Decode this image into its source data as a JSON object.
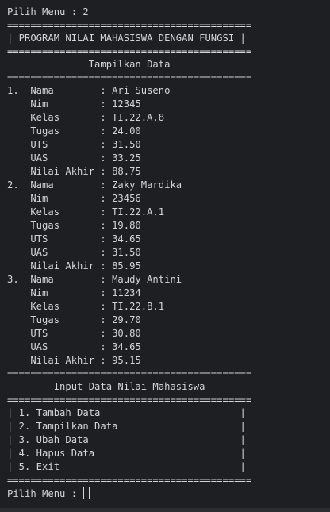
{
  "terminal": {
    "lines": [
      "Pilih Menu : 2",
      "==========================================",
      "| PROGRAM NILAI MAHASISWA DENGAN FUNGSI |",
      "==========================================",
      "              Tampilkan Data",
      "==========================================",
      "1.  Nama        : Ari Suseno",
      "    Nim         : 12345",
      "    Kelas       : TI.22.A.8",
      "    Tugas       : 24.00",
      "    UTS         : 31.50",
      "    UAS         : 33.25",
      "    Nilai Akhir : 88.75",
      "2.  Nama        : Zaky Mardika",
      "    Nim         : 23456",
      "    Kelas       : TI.22.A.1",
      "    Tugas       : 19.80",
      "    UTS         : 34.65",
      "    UAS         : 31.50",
      "    Nilai Akhir : 85.95",
      "3.  Nama        : Maudy Antini",
      "    Nim         : 11234",
      "    Kelas       : TI.22.B.1",
      "    Tugas       : 29.70",
      "    UTS         : 30.80",
      "    UAS         : 34.65",
      "    Nilai Akhir : 95.15",
      "==========================================",
      "        Input Data Nilai Mahasiswa",
      "==========================================",
      "| 1. Tambah Data                        |",
      "| 2. Tampilkan Data                     |",
      "| 3. Ubah Data                          |",
      "| 4. Hapus Data                         |",
      "| 5. Exit                               |",
      "=========================================="
    ],
    "prompt": "Pilih Menu : "
  }
}
